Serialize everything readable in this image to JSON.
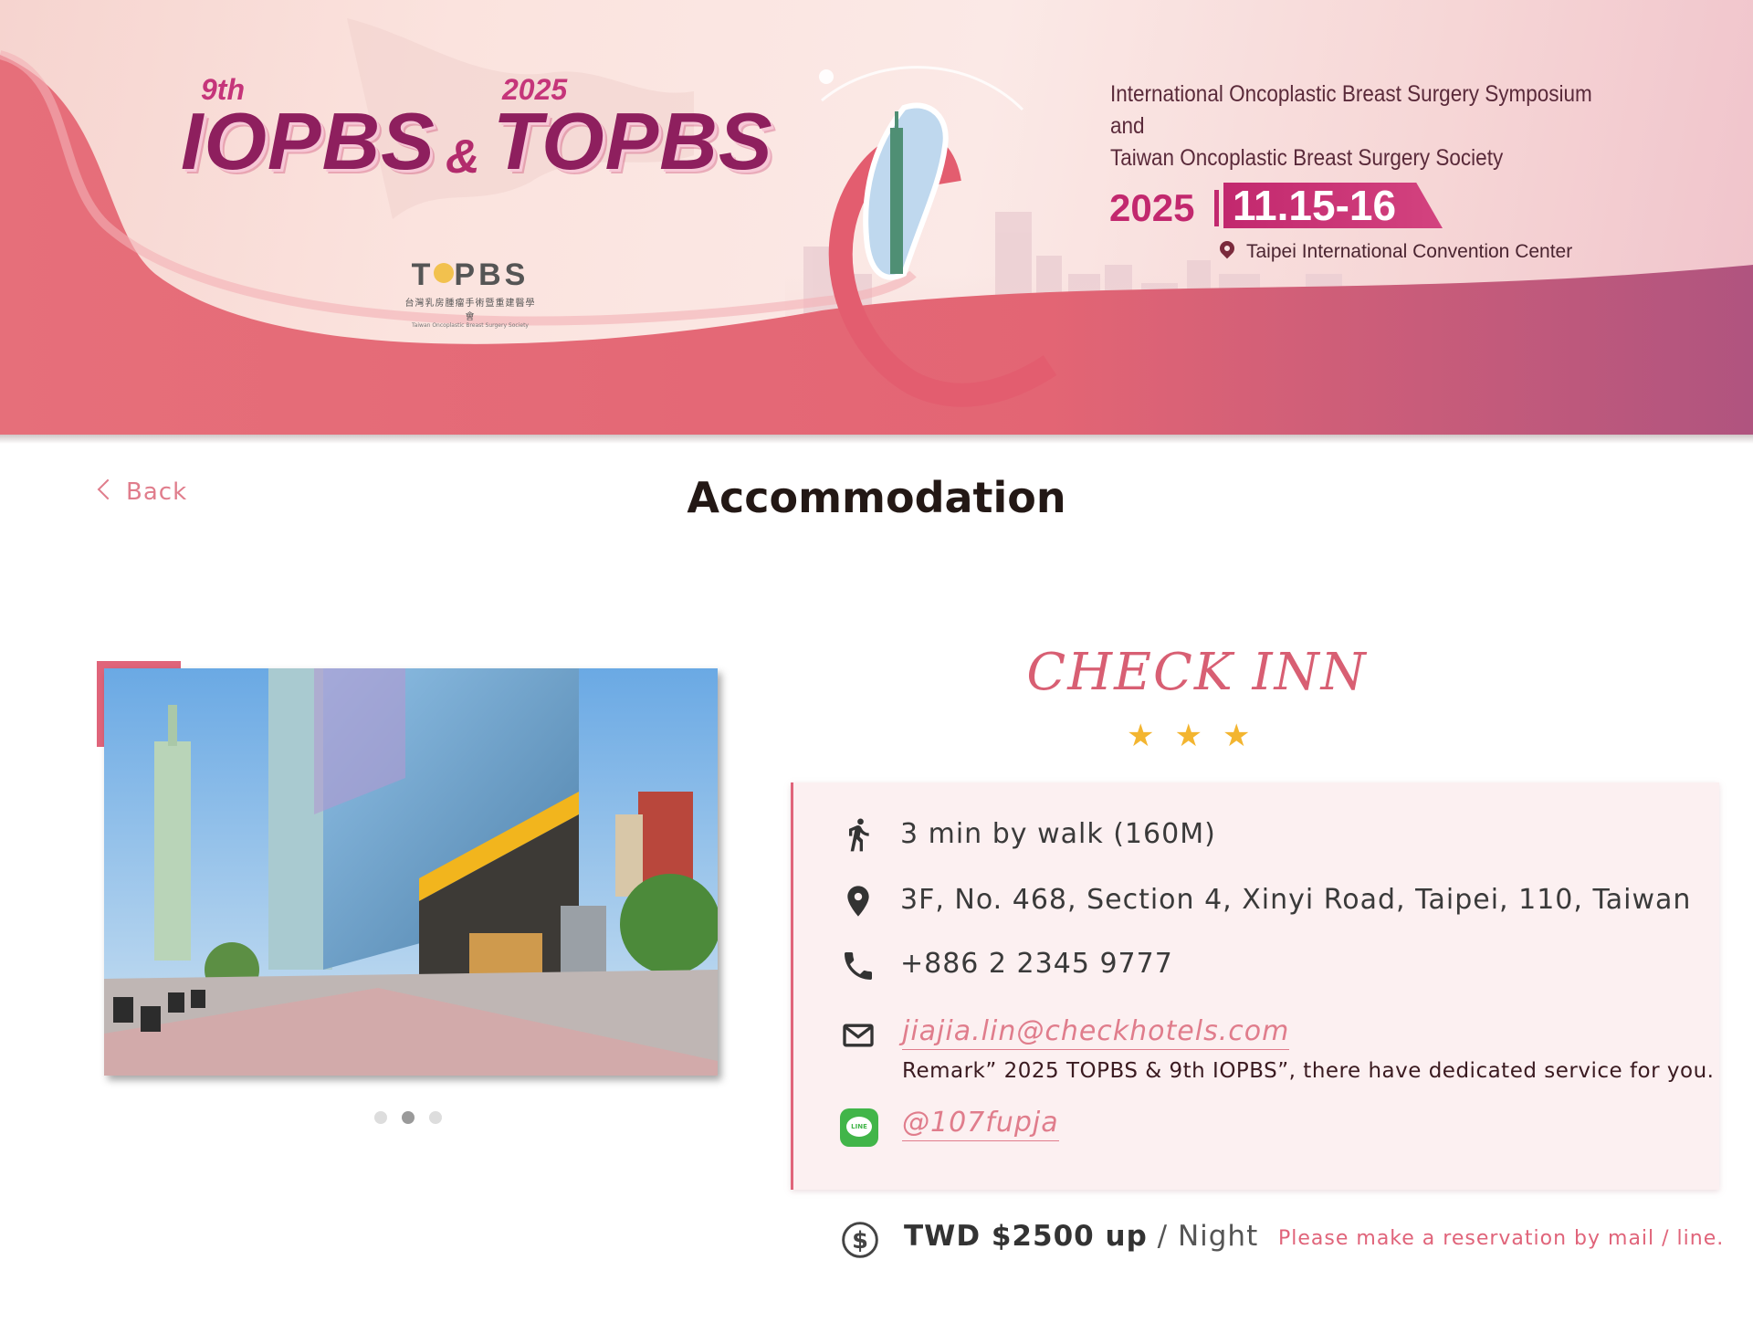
{
  "banner": {
    "edition": "9th",
    "event1": "IOPBS",
    "amp": "&",
    "year_small": "2025",
    "event2": "TOPBS",
    "logo_mark_left": "T",
    "logo_mark_right": "PBS",
    "logo_cn": "台灣乳房腫瘤手術暨重建醫學會",
    "logo_en": "Taiwan Oncoplastic Breast Surgery Society",
    "symposium_line1": "International Oncoplastic Breast Surgery Symposium",
    "symposium_line2": "and",
    "symposium_line3": "Taiwan Oncoplastic Breast Surgery Society",
    "date_year": "2025",
    "date_days": "11.15-16",
    "venue": "Taipei International Convention Center"
  },
  "nav": {
    "back_label": "Back",
    "page_title": "Accommodation"
  },
  "gallery": {
    "total": 3,
    "active": 2
  },
  "hotel": {
    "name": "CHECK INN",
    "stars": 3,
    "distance": "3 min by walk (160M)",
    "address": "3F, No. 468, Section 4, Xinyi Road, Taipei, 110, Taiwan",
    "phone": "+886 2 2345 9777",
    "email": "jiajia.lin@checkhotels.com",
    "remark": "Remark” 2025 TOPBS & 9th IOPBS”, there have dedicated service for you.",
    "line_badge": "LINE",
    "line_id": "@107fupja",
    "price": "TWD $2500 up",
    "price_unit": "/ Night",
    "reservation_note": "Please make a reservation by mail / line."
  },
  "colors": {
    "accent": "#e0647a",
    "brand_magenta": "#c2286e",
    "star": "#f3b530",
    "line_green": "#41b549",
    "info_bg": "#fcf0f1"
  }
}
